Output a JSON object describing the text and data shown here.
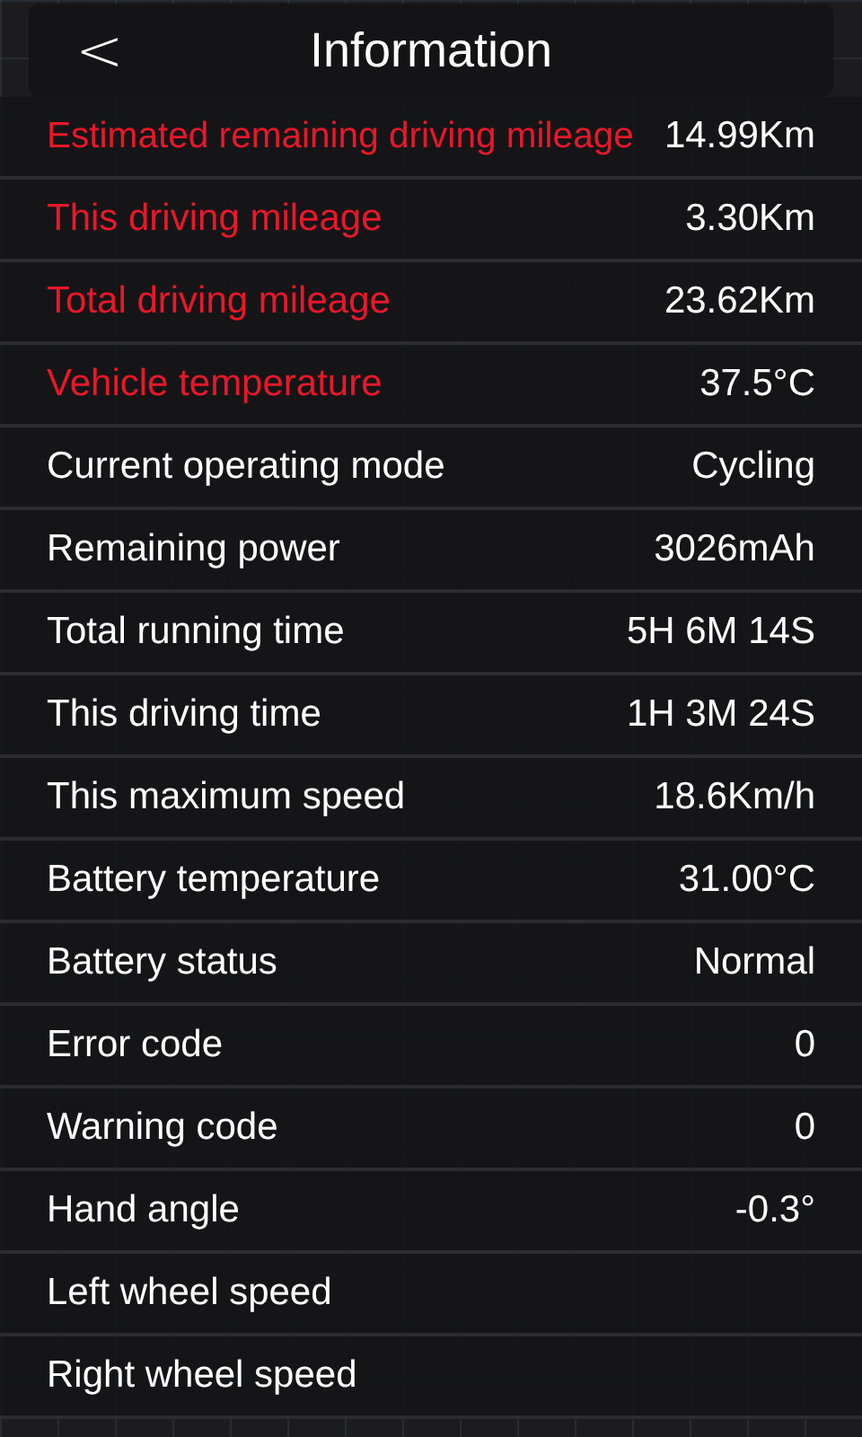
{
  "header": {
    "back": "<",
    "title": "Information"
  },
  "rows": [
    {
      "label": "Estimated remaining driving mileage",
      "value": "14.99Km",
      "alert": true
    },
    {
      "label": "This driving mileage",
      "value": "3.30Km",
      "alert": true
    },
    {
      "label": "Total driving mileage",
      "value": "23.62Km",
      "alert": true
    },
    {
      "label": "Vehicle temperature",
      "value": "37.5°C",
      "alert": true
    },
    {
      "label": "Current operating mode",
      "value": "Cycling",
      "alert": false
    },
    {
      "label": "Remaining power",
      "value": "3026mAh",
      "alert": false
    },
    {
      "label": "Total running time",
      "value": "5H 6M 14S",
      "alert": false
    },
    {
      "label": "This driving time",
      "value": "1H 3M 24S",
      "alert": false
    },
    {
      "label": "This maximum speed",
      "value": "18.6Km/h",
      "alert": false
    },
    {
      "label": "Battery temperature",
      "value": "31.00°C",
      "alert": false
    },
    {
      "label": "Battery status",
      "value": "Normal",
      "alert": false
    },
    {
      "label": "Error code",
      "value": "0",
      "alert": false
    },
    {
      "label": "Warning code",
      "value": "0",
      "alert": false
    },
    {
      "label": "Hand angle",
      "value": "-0.3°",
      "alert": false
    },
    {
      "label": "Left wheel speed",
      "alert": false
    },
    {
      "label": "Right wheel speed",
      "alert": false
    }
  ]
}
